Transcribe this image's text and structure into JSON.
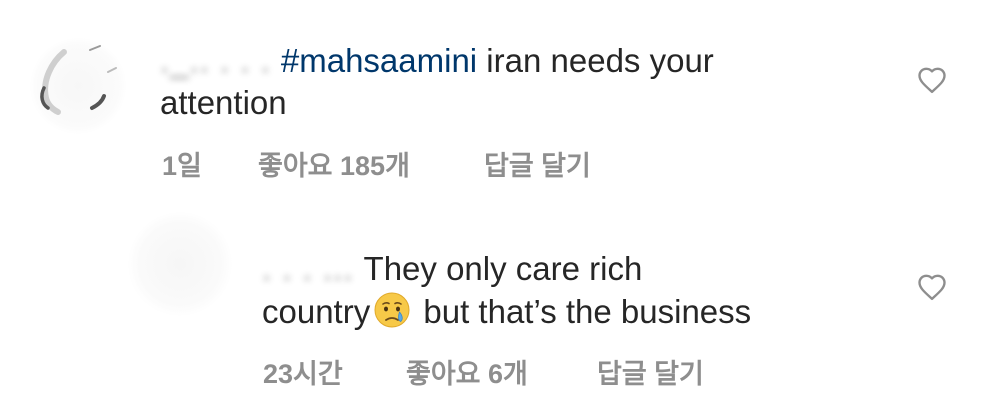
{
  "comments": [
    {
      "username": "._.. . . .",
      "hashtag": "#mahsaamini",
      "text_line1": " iran needs your",
      "text_line2": "attention",
      "time": "1일",
      "likes": "좋아요 185개",
      "reply": "답글 달기",
      "like_icon": "heart-outline-icon"
    },
    {
      "username": ". . .  ...",
      "text_line1": "They only care rich",
      "text_line2_before_emoji": "country",
      "emoji": "crying-face",
      "text_line2_after_emoji": " but that’s the business",
      "time": "23시간",
      "likes": "좋아요 6개",
      "reply": "답글 달기",
      "like_icon": "heart-outline-icon"
    }
  ],
  "colors": {
    "text": "#262626",
    "hashtag": "#00376b",
    "meta": "#8e8e8e",
    "heart": "#8e8e8e",
    "background": "#ffffff"
  }
}
